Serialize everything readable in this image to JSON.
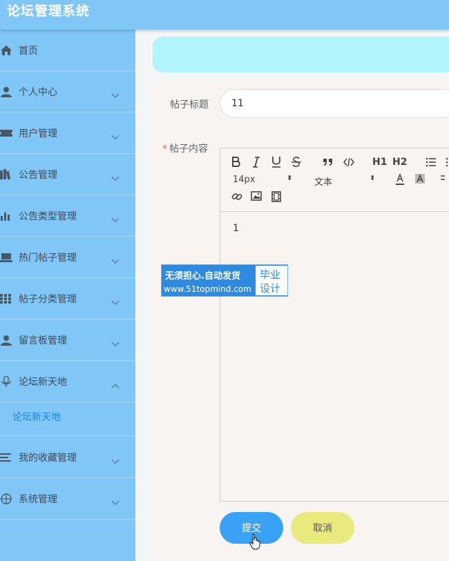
{
  "header": {
    "title": "论坛管理系统"
  },
  "sidebar": {
    "items": [
      {
        "label": "首页",
        "icon": "home-icon"
      },
      {
        "label": "个人中心",
        "icon": "user-icon"
      },
      {
        "label": "用户管理",
        "icon": "ticket-icon"
      },
      {
        "label": "公告管理",
        "icon": "books-icon"
      },
      {
        "label": "公告类型管理",
        "icon": "bar-chart-icon"
      },
      {
        "label": "热门帖子管理",
        "icon": "laptop-icon"
      },
      {
        "label": "帖子分类管理",
        "icon": "grid-icon"
      },
      {
        "label": "留言板管理",
        "icon": "user-icon"
      },
      {
        "label": "论坛新天地",
        "icon": "microphone-icon",
        "expanded": true
      },
      {
        "label": "我的收藏管理",
        "icon": "list-icon"
      },
      {
        "label": "系统管理",
        "icon": "crosshair-icon"
      }
    ],
    "sub_item": "论坛新天地"
  },
  "form": {
    "title_label": "帖子标题",
    "title_value": "11",
    "content_required": "*",
    "content_label": "帖子内容",
    "content_value": "1",
    "submit_label": "提交",
    "cancel_label": "取消"
  },
  "editor_toolbar": {
    "font_size": "14px",
    "header_select": "文本",
    "h1": "H1",
    "h2": "H2"
  },
  "watermark": {
    "line1": "无须担心.自动发货",
    "line2": "www.51topmind.com",
    "right1": "毕业",
    "right2": "设计"
  },
  "colors": {
    "topbar": "#80c6f7",
    "sidebar": "#80c6f7",
    "banner": "#b3f5fc",
    "submit": "#3aa2f5",
    "cancel": "#e8ea7d",
    "active_sub": "#1d86d6"
  }
}
